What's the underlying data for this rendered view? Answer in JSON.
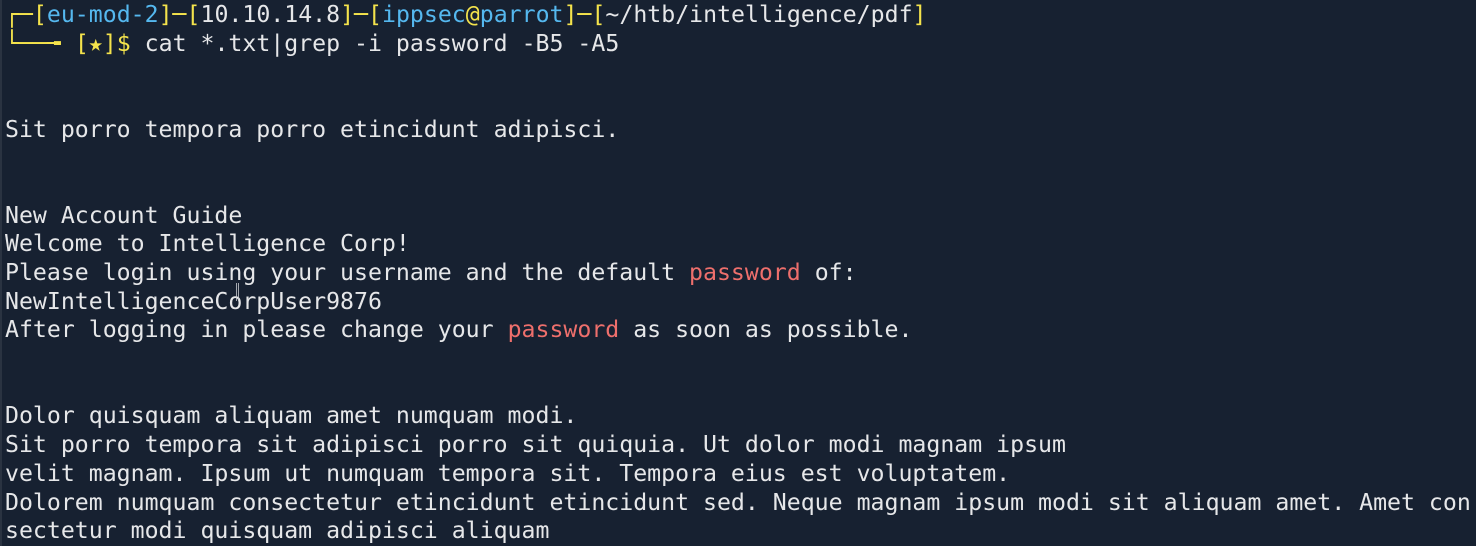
{
  "prompt": {
    "corner_top": "┌─",
    "lb1": "[",
    "server": "eu-mod-2",
    "rb1": "]",
    "dash1": "─",
    "lb2": "[",
    "ip": "10.10.14.8",
    "rb2": "]",
    "dash2": "─",
    "lb3": "[",
    "user": "ippsec",
    "at": "@",
    "host": "parrot",
    "rb3": "]",
    "dash3": "─",
    "lb4": "[",
    "path": "~/htb/intelligence/pdf",
    "rb4": "]",
    "corner_bottom": "└──╼ ",
    "status_open": "[",
    "status_star": "★",
    "status_close": "]",
    "dollar": "$",
    "command": " cat *.txt|grep -i password -B5 -A5"
  },
  "output": {
    "line1": "Sit porro tempora porro etincidunt adipisci.",
    "line2": "New Account Guide",
    "line3": "Welcome to Intelligence Corp!",
    "line4_before": "Please login using your username and the default ",
    "line4_match": "password",
    "line4_after": " of:",
    "line5": "NewIntelligenceCorpUser9876",
    "line6_before": "After logging in please change your ",
    "line6_match": "password",
    "line6_after": " as soon as possible.",
    "line7": "Dolor quisquam aliquam amet numquam modi.",
    "line8": "Sit porro tempora sit adipisci porro sit quiquia. Ut dolor modi magnam ipsum",
    "line9": "velit magnam. Ipsum ut numquam tempora sit. Tempora eius est voluptatem.",
    "line10": "Dolorem numquam consectetur etincidunt etincidunt sed. Neque magnam ipsum modi sit aliquam amet. Amet con",
    "line11": "sectetur modi quisquam adipisci aliquam"
  },
  "colors": {
    "background": "#172131",
    "text": "#e6e7e9",
    "prompt_frame": "#f4e34c",
    "prompt_host": "#55b8ef",
    "grep_match": "#ee6f6c"
  }
}
